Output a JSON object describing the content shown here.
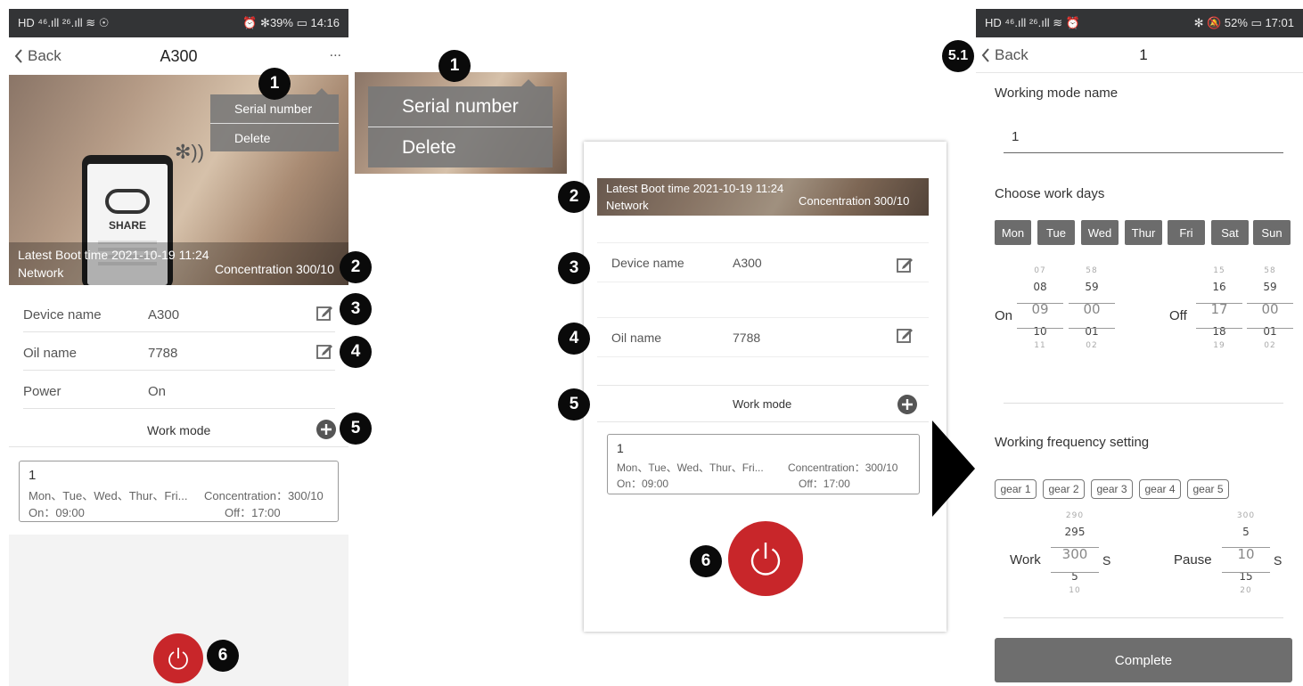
{
  "phone1": {
    "status": {
      "left": "HD ⁴⁶.ıll ²⁶.ıll ≋ ☉",
      "right": "⏰ ✻39% ▭ 14:16"
    },
    "nav": {
      "back": "Back",
      "title": "A300",
      "more": "..."
    },
    "menu": {
      "items": [
        "Serial number",
        "Delete"
      ]
    },
    "banner": {
      "boot_label": "Latest Boot time",
      "boot_time": "2021-10-19 11:24",
      "network": "Network",
      "concentration": "Concentration 300/10"
    },
    "screen": {
      "share_text": "SHARE"
    },
    "fields": [
      {
        "label": "Device name",
        "value": "A300"
      },
      {
        "label": "Oil name",
        "value": "7788"
      },
      {
        "label": "Power",
        "value": "On"
      }
    ],
    "work_mode": {
      "label": "Work mode"
    },
    "mode_card": {
      "name": "1",
      "days": "Mon、Tue、Wed、Thur、Fri...",
      "concentration": "Concentration：300/10",
      "on": "On：09:00",
      "off": "Off：17:00"
    }
  },
  "zoom_menu": {
    "items": [
      "Serial number",
      "Delete"
    ]
  },
  "middle": {
    "banner": {
      "boot_label": "Latest Boot time",
      "boot_time": "2021-10-19 11:24",
      "network": "Network",
      "concentration": "Concentration 300/10"
    },
    "fields": [
      {
        "label": "Device name",
        "value": "A300"
      },
      {
        "label": "Oil name",
        "value": "7788"
      }
    ],
    "work_mode": {
      "label": "Work mode"
    },
    "mode_card": {
      "name": "1",
      "days": "Mon、Tue、Wed、Thur、Fri...",
      "concentration": "Concentration：300/10",
      "on": "On：09:00",
      "off": "Off：17:00"
    }
  },
  "badges": {
    "b1": "1",
    "b2": "2",
    "b3": "3",
    "b4": "4",
    "b5": "5",
    "b6": "6",
    "b51": "5.1"
  },
  "phone2": {
    "status": {
      "left": "HD ⁴⁶.ıll ²⁶.ıll ≋ ⏰",
      "right": "✻ 🔕 52% ▭ 17:01"
    },
    "nav": {
      "back": "Back",
      "title": "1"
    },
    "mode_name_label": "Working mode name",
    "mode_name_value": "1",
    "work_days_label": "Choose work days",
    "days": [
      "Mon",
      "Tue",
      "Wed",
      "Thur",
      "Fri",
      "Sat",
      "Sun"
    ],
    "on_label": "On",
    "off_label": "Off",
    "on_hour": [
      "07",
      "08",
      "09",
      "10",
      "11"
    ],
    "on_min": [
      "58",
      "59",
      "00",
      "01",
      "02"
    ],
    "off_hour": [
      "15",
      "16",
      "17",
      "18",
      "19"
    ],
    "off_min": [
      "58",
      "59",
      "00",
      "01",
      "02"
    ],
    "freq_label": "Working frequency setting",
    "gears": [
      "gear 1",
      "gear 2",
      "gear 3",
      "gear 4",
      "gear 5"
    ],
    "work_label": "Work",
    "pause_label": "Pause",
    "unit": "S",
    "work_vals": [
      "290",
      "295",
      "300",
      "5",
      "10"
    ],
    "pause_vals": [
      "300",
      "5",
      "10",
      "15",
      "20"
    ],
    "complete": "Complete"
  },
  "colors": {
    "accent_red": "#c8262a",
    "button_grey": "#6c6c6c",
    "status_bar": "#333436",
    "badge": "#0a0a0a"
  }
}
